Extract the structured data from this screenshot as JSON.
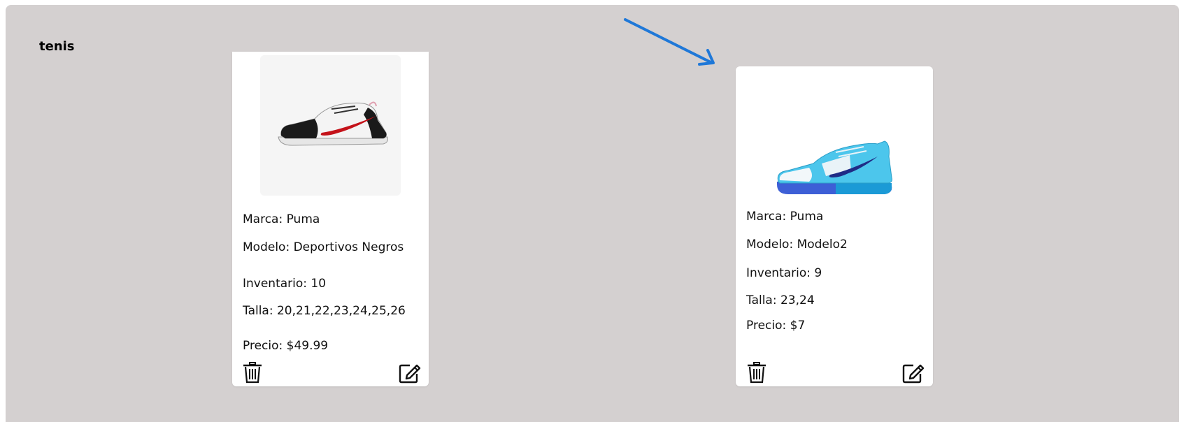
{
  "section": {
    "title": "tenis"
  },
  "products": [
    {
      "brand_label": "Marca: Puma",
      "model_label": "Modelo: Deportivos Negros",
      "inventory_label": "Inventario: 10",
      "size_label": "Talla: 20,21,22,23,24,25,26",
      "price_label": "Precio: $49.99",
      "image": "shoe-white-black-red",
      "delete_icon": "trash-icon",
      "edit_icon": "edit-icon"
    },
    {
      "brand_label": "Marca: Puma",
      "model_label": "Modelo: Modelo2",
      "inventory_label": "Inventario: 9",
      "size_label": "Talla: 23,24",
      "price_label": "Precio: $7",
      "image": "shoe-light-blue",
      "delete_icon": "trash-icon",
      "edit_icon": "edit-icon"
    }
  ],
  "colors": {
    "panel_bg": "#d4d0d0",
    "card_bg": "#ffffff",
    "arrow": "#1f78d8"
  }
}
